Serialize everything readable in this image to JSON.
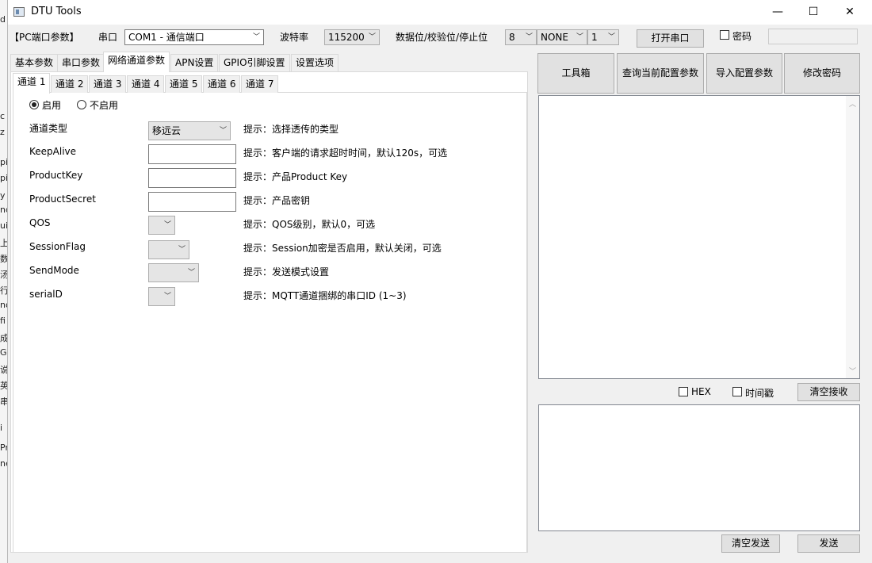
{
  "window": {
    "title": "DTU Tools",
    "minimize": "—",
    "maximize": "☐",
    "close": "✕"
  },
  "background_strip": [
    "d",
    "c",
    "z",
    "pi",
    "pi",
    "y",
    "nd",
    "ui",
    "上",
    "数",
    "汤",
    "行",
    "no",
    "fi",
    "成",
    "G",
    "说",
    "英",
    "串",
    "i",
    "Pr",
    "ne"
  ],
  "serial": {
    "section_label": "【PC端口参数】",
    "port_label": "串口",
    "port_value": "COM1 - 通信端口",
    "baud_label": "波特率",
    "baud_value": "115200",
    "bits_label": "数据位/校验位/停止位",
    "data_bits": "8",
    "parity": "NONE",
    "stop_bits": "1",
    "open_button": "打开串口",
    "password_label": "密码",
    "password_value": ""
  },
  "main_tabs": [
    "基本参数",
    "串口参数",
    "网络通道参数",
    "APN设置",
    "GPIO引脚设置",
    "设置选项"
  ],
  "channel_tabs": [
    "通道 1",
    "通道 2",
    "通道 3",
    "通道 4",
    "通道 5",
    "通道 6",
    "通道 7"
  ],
  "channel": {
    "enable_label": "启用",
    "disable_label": "不启用",
    "enabled": true,
    "fields": [
      {
        "label": "通道类型",
        "value": "移远云",
        "hint": "提示：选择透传的类型"
      },
      {
        "label": "KeepAlive",
        "value": "",
        "hint": "提示：客户端的请求超时时间，默认120s，可选"
      },
      {
        "label": "ProductKey",
        "value": "",
        "hint": "提示：产品Product Key"
      },
      {
        "label": "ProductSecret",
        "value": "",
        "hint": "提示：产品密钥"
      },
      {
        "label": "QOS",
        "value": "",
        "hint": "提示：QOS级别，默认0，可选"
      },
      {
        "label": "SessionFlag",
        "value": "",
        "hint": "提示：Session加密是否启用，默认关闭，可选"
      },
      {
        "label": "SendMode",
        "value": "",
        "hint": "提示：发送模式设置"
      },
      {
        "label": "serialD",
        "value": "",
        "hint": "提示：MQTT通道捆绑的串口ID (1~3)"
      }
    ]
  },
  "right": {
    "toolbox_button": "工具箱",
    "query_button": "查询当前配置参数",
    "import_button": "导入配置参数",
    "change_pwd_button": "修改密码",
    "hex_label": "HEX",
    "timestamp_label": "时间戳",
    "clear_recv_button": "清空接收",
    "clear_send_button": "清空发送",
    "send_button": "发送"
  },
  "icons": {
    "dropdown": "chevron-down-icon",
    "scroll_up": "chevron-up-icon",
    "scroll_down": "chevron-down-icon"
  },
  "colors": {
    "window_bg": "#f0f0f0",
    "button_bg": "#e1e1e1",
    "border": "#adadad"
  }
}
